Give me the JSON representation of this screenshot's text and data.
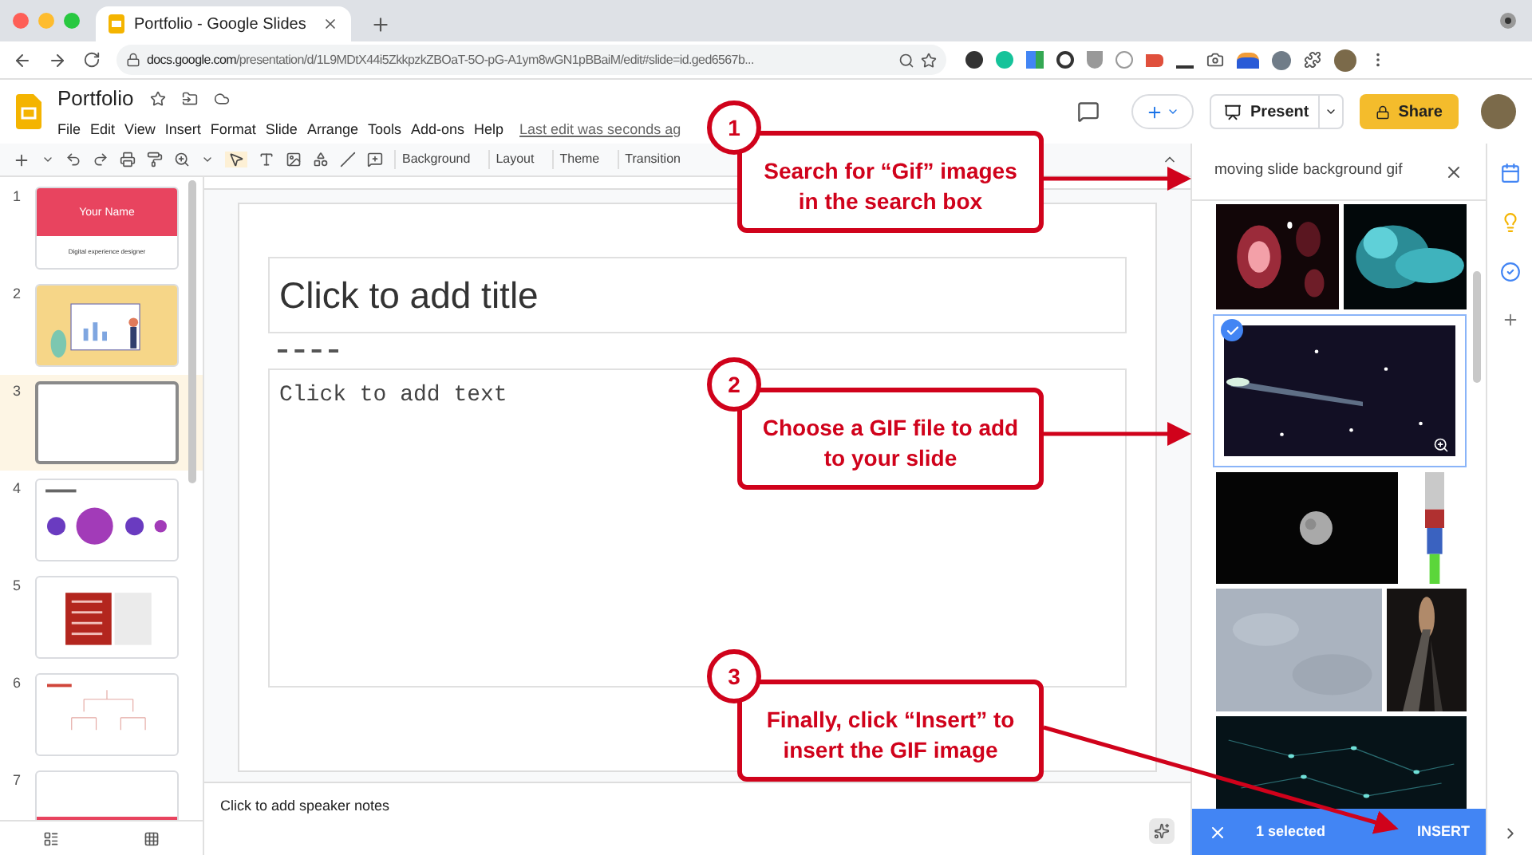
{
  "browser": {
    "tab_title": "Portfolio - Google Slides",
    "url_domain": "docs.google.com",
    "url_path": "/presentation/d/1L9MDtX44i5ZkkpzkZBOaT-5O-pG-A1ym8wGN1pBBaiM/edit#slide=id.ged6567b..."
  },
  "doc": {
    "title": "Portfolio",
    "menu": [
      "File",
      "Edit",
      "View",
      "Insert",
      "Format",
      "Slide",
      "Arrange",
      "Tools",
      "Add-ons",
      "Help"
    ],
    "last_edit": "Last edit was seconds ag",
    "present": "Present",
    "share": "Share"
  },
  "toolbar": [
    "Background",
    "Layout",
    "Theme",
    "Transition"
  ],
  "slides": [
    {
      "number": "1",
      "kind": "title",
      "title": "Your Name",
      "subtitle": "Digital experience designer",
      "selected": false
    },
    {
      "number": "2",
      "kind": "illustration",
      "selected": false
    },
    {
      "number": "3",
      "kind": "blank",
      "selected": true
    },
    {
      "number": "4",
      "kind": "circles",
      "selected": false
    },
    {
      "number": "5",
      "kind": "list",
      "selected": false
    },
    {
      "number": "6",
      "kind": "tree",
      "selected": false
    },
    {
      "number": "7",
      "kind": "banner",
      "selected": false
    }
  ],
  "canvas": {
    "title_placeholder": "Click to add title",
    "body_placeholder": "Click to add text",
    "notes_placeholder": "Click to add speaker notes"
  },
  "search_panel": {
    "query": "moving slide background gif",
    "images": [
      {
        "kind": "picture",
        "selected": false
      },
      {
        "kind": "picture",
        "selected": false
      },
      {
        "kind": "picture",
        "selected": true
      },
      {
        "kind": "picture",
        "selected": false
      },
      {
        "kind": "picture",
        "selected": false
      },
      {
        "kind": "picture",
        "selected": false
      },
      {
        "kind": "picture",
        "selected": false
      },
      {
        "kind": "picture",
        "selected": false
      }
    ],
    "selection_count": "1 selected",
    "insert": "INSERT"
  },
  "callouts": [
    {
      "number": "1",
      "text": "Search for “Gif” images in the search box"
    },
    {
      "number": "2",
      "text": "Choose a GIF file to add to your slide"
    },
    {
      "number": "3",
      "text": "Finally, click “Insert” to insert the GIF image"
    }
  ]
}
